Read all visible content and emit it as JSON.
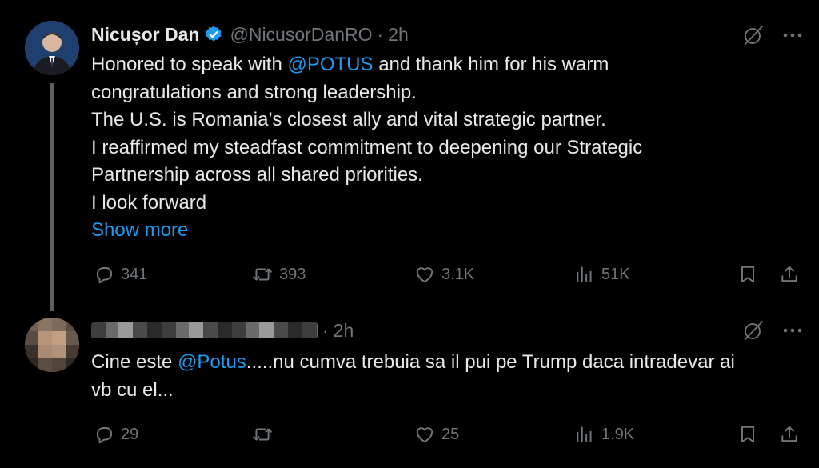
{
  "tweet": {
    "author_name": "Nicușor Dan",
    "handle": "@NicusorDanRO",
    "separator": "·",
    "time": "2h",
    "text": {
      "l1_pre": "Honored to speak with ",
      "l1_mention": "@POTUS",
      "l1_post": " and thank him for his warm",
      "l2": "congratulations and strong leadership.",
      "l3": "The U.S. is Romania’s closest ally and vital strategic partner.",
      "l4": "I reaffirmed my steadfast commitment to deepening our Strategic",
      "l5": "Partnership across all shared priorities.",
      "l6": "I look forward"
    },
    "show_more": "Show more",
    "replies": "341",
    "reposts": "393",
    "likes": "3.1K",
    "views": "51K",
    "accent_color": "#1d9bf0"
  },
  "reply": {
    "separator": "·",
    "time": "2h",
    "text": {
      "l1_pre": "Cine este ",
      "l1_mention": "@Potus",
      "l1_post": ".....nu cumva trebuia sa il pui pe Trump daca intradevar ai",
      "l2": "vb cu el..."
    },
    "replies": "29",
    "reposts": "",
    "likes": "25",
    "views": "1.9K"
  },
  "icons": [
    "verified-badge-icon",
    "grok-icon",
    "more-icon",
    "reply-icon",
    "repost-icon",
    "like-icon",
    "views-icon",
    "bookmark-icon",
    "share-icon"
  ]
}
